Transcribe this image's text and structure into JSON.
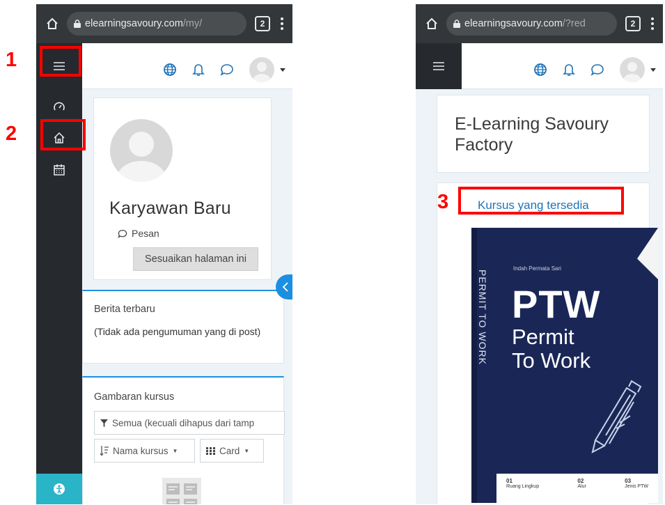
{
  "left_screen": {
    "browser": {
      "url_host": "elearningsavoury.com",
      "url_path": "/my/",
      "tab_count": "2"
    },
    "profile": {
      "name": "Karyawan Baru",
      "message_label": "Pesan",
      "customize_button": "Sesuaikan halaman ini"
    },
    "news_block": {
      "title": "Berita terbaru",
      "text": "(Tidak ada pengumuman yang di post)"
    },
    "overview_block": {
      "title": "Gambaran kursus",
      "filter_label": "Semua (kecuali dihapus dari tamp",
      "sort_label": "Nama kursus",
      "view_label": "Card"
    }
  },
  "right_screen": {
    "browser": {
      "url_host": "elearningsavoury.com",
      "url_path": "/?red",
      "tab_count": "2"
    },
    "site_title": "E-Learning Savoury Factory",
    "courses_link": "Kursus yang tersedia",
    "course_image": {
      "author": "Indah Permata Sari",
      "spine": "PERMIT TO WORK",
      "title": "PTW",
      "subtitle": "Permit To Work",
      "footer": [
        {
          "num": "01",
          "label": "Ruang Lingkup"
        },
        {
          "num": "02",
          "label": "Alur"
        },
        {
          "num": "03",
          "label": "Jenis PTW"
        }
      ]
    }
  },
  "annotations": [
    {
      "number": "1"
    },
    {
      "number": "2"
    },
    {
      "number": "3"
    }
  ],
  "colors": {
    "annotation": "#ff0000",
    "drawer": "#262a2e",
    "link": "#1f73b7",
    "browser_bar": "#34373a"
  }
}
